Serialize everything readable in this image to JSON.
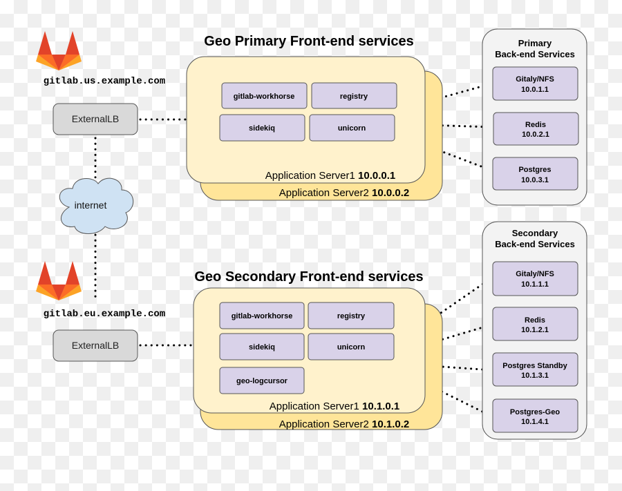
{
  "colors": {
    "server_front": "#fff2cc",
    "server_back": "#ffe599",
    "service": "#d9d2e9",
    "lb": "#d9d9d9",
    "cloud": "#cfe2f3",
    "backend_panel": "#f3f3f3"
  },
  "primary": {
    "host": "gitlab.us.example.com",
    "lb": "ExternalLB",
    "title": "Geo Primary Front-end services",
    "services": [
      "gitlab-workhorse",
      "registry",
      "sidekiq",
      "unicorn"
    ],
    "server1": {
      "label": "Application Server1",
      "ip": "10.0.0.1"
    },
    "server2": {
      "label": "Application Server2",
      "ip": "10.0.0.2"
    },
    "backend": {
      "title1": "Primary",
      "title2": "Back-end Services",
      "items": [
        {
          "name": "Gitaly/NFS",
          "ip": "10.0.1.1"
        },
        {
          "name": "Redis",
          "ip": "10.0.2.1"
        },
        {
          "name": "Postgres",
          "ip": "10.0.3.1"
        }
      ]
    }
  },
  "internet": "internet",
  "secondary": {
    "host": "gitlab.eu.example.com",
    "lb": "ExternalLB",
    "title": "Geo Secondary Front-end services",
    "services": [
      "gitlab-workhorse",
      "registry",
      "sidekiq",
      "unicorn",
      "geo-logcursor"
    ],
    "server1": {
      "label": "Application Server1",
      "ip": "10.1.0.1"
    },
    "server2": {
      "label": "Application Server2",
      "ip": "10.1.0.2"
    },
    "backend": {
      "title1": "Secondary",
      "title2": "Back-end Services",
      "items": [
        {
          "name": "Gitaly/NFS",
          "ip": "10.1.1.1"
        },
        {
          "name": "Redis",
          "ip": "10.1.2.1"
        },
        {
          "name": "Postgres Standby",
          "ip": "10.1.3.1"
        },
        {
          "name": "Postgres-Geo",
          "ip": "10.1.4.1"
        }
      ]
    }
  }
}
